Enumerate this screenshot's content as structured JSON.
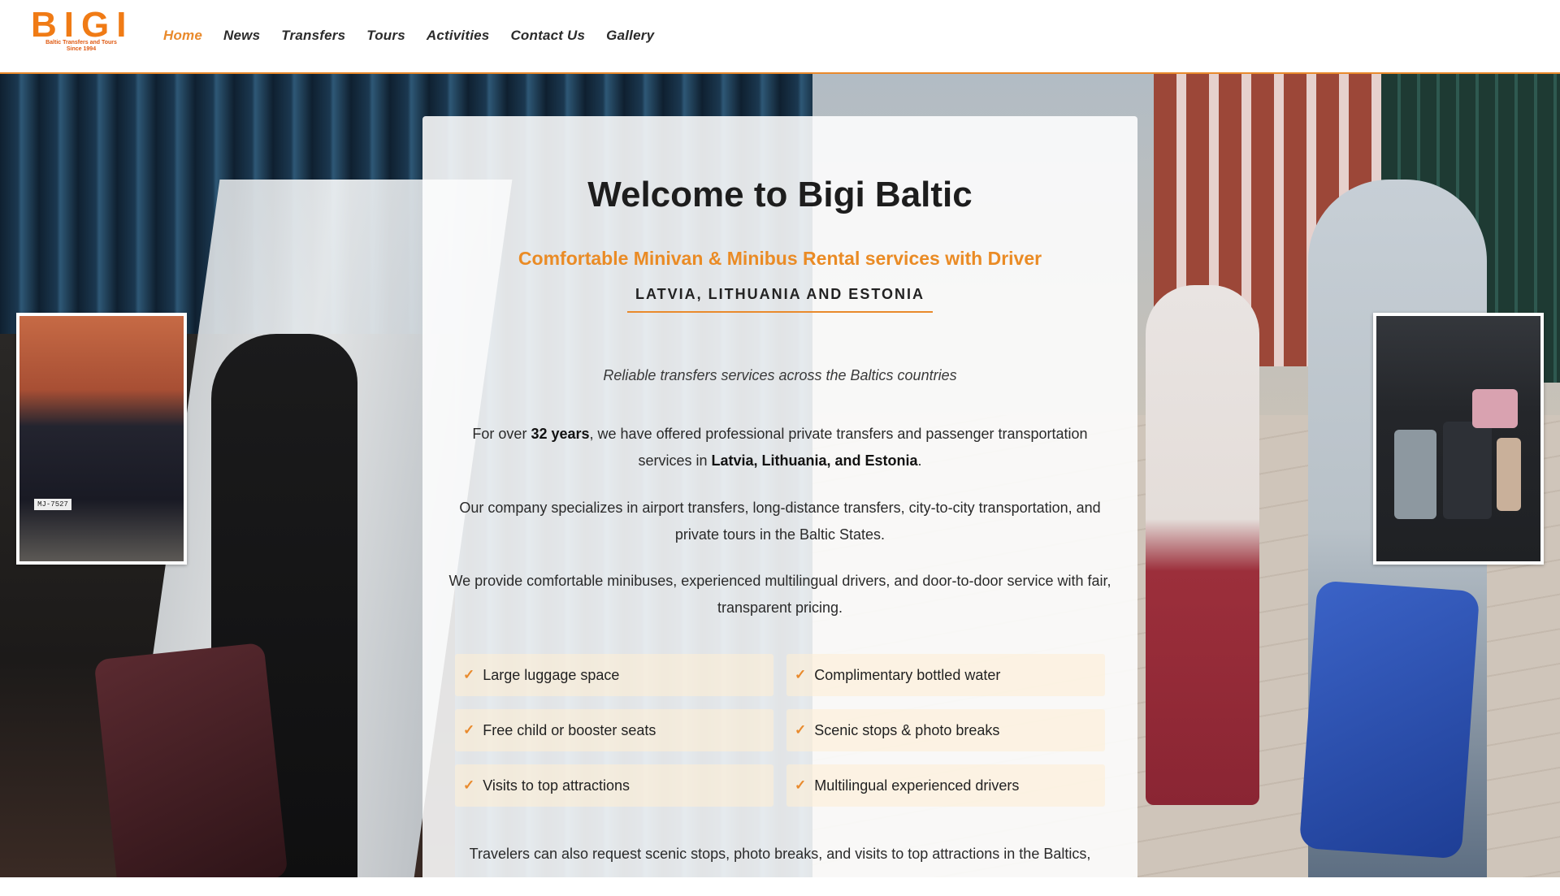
{
  "brand": {
    "logo_text": "BIGI",
    "logo_tagline_1": "Baltic Transfers and Tours",
    "logo_tagline_2": "Since 1994",
    "accent_color": "#e98a2c"
  },
  "nav": {
    "items": [
      {
        "label": "Home",
        "active": true
      },
      {
        "label": "News"
      },
      {
        "label": "Transfers"
      },
      {
        "label": "Tours"
      },
      {
        "label": "Activities"
      },
      {
        "label": "Contact Us"
      },
      {
        "label": "Gallery"
      }
    ]
  },
  "hero": {
    "title": "Welcome to Bigi Baltic",
    "subtitle": "Comfortable Minivan & Minibus Rental services with Driver",
    "region": "LATVIA, LITHUANIA AND ESTONIA",
    "tagline": "Reliable transfers services across the Baltics countries",
    "p1_pre": "For over ",
    "p1_bold1": "32 years",
    "p1_mid": ", we have offered professional private transfers and passenger transportation services in ",
    "p1_bold2": "Latvia, Lithuania, and Estonia",
    "p1_end": ".",
    "p2": "Our company specializes in airport transfers, long-distance transfers, city-to-city transportation, and private tours in the Baltic States.",
    "p3": "We provide comfortable minibuses, experienced multilingual drivers, and door-to-door service with fair, transparent pricing.",
    "p4": "Travelers can also request scenic stops, photo breaks, and visits to top attractions in the Baltics,"
  },
  "features": [
    "Large luggage space",
    "Complimentary bottled water",
    "Free child or booster seats",
    "Scenic stops & photo breaks",
    "Visits to top attractions",
    "Multilingual experienced drivers"
  ],
  "photos": {
    "van_plate": "MJ-7527"
  },
  "icons": {
    "check": "check-icon"
  }
}
